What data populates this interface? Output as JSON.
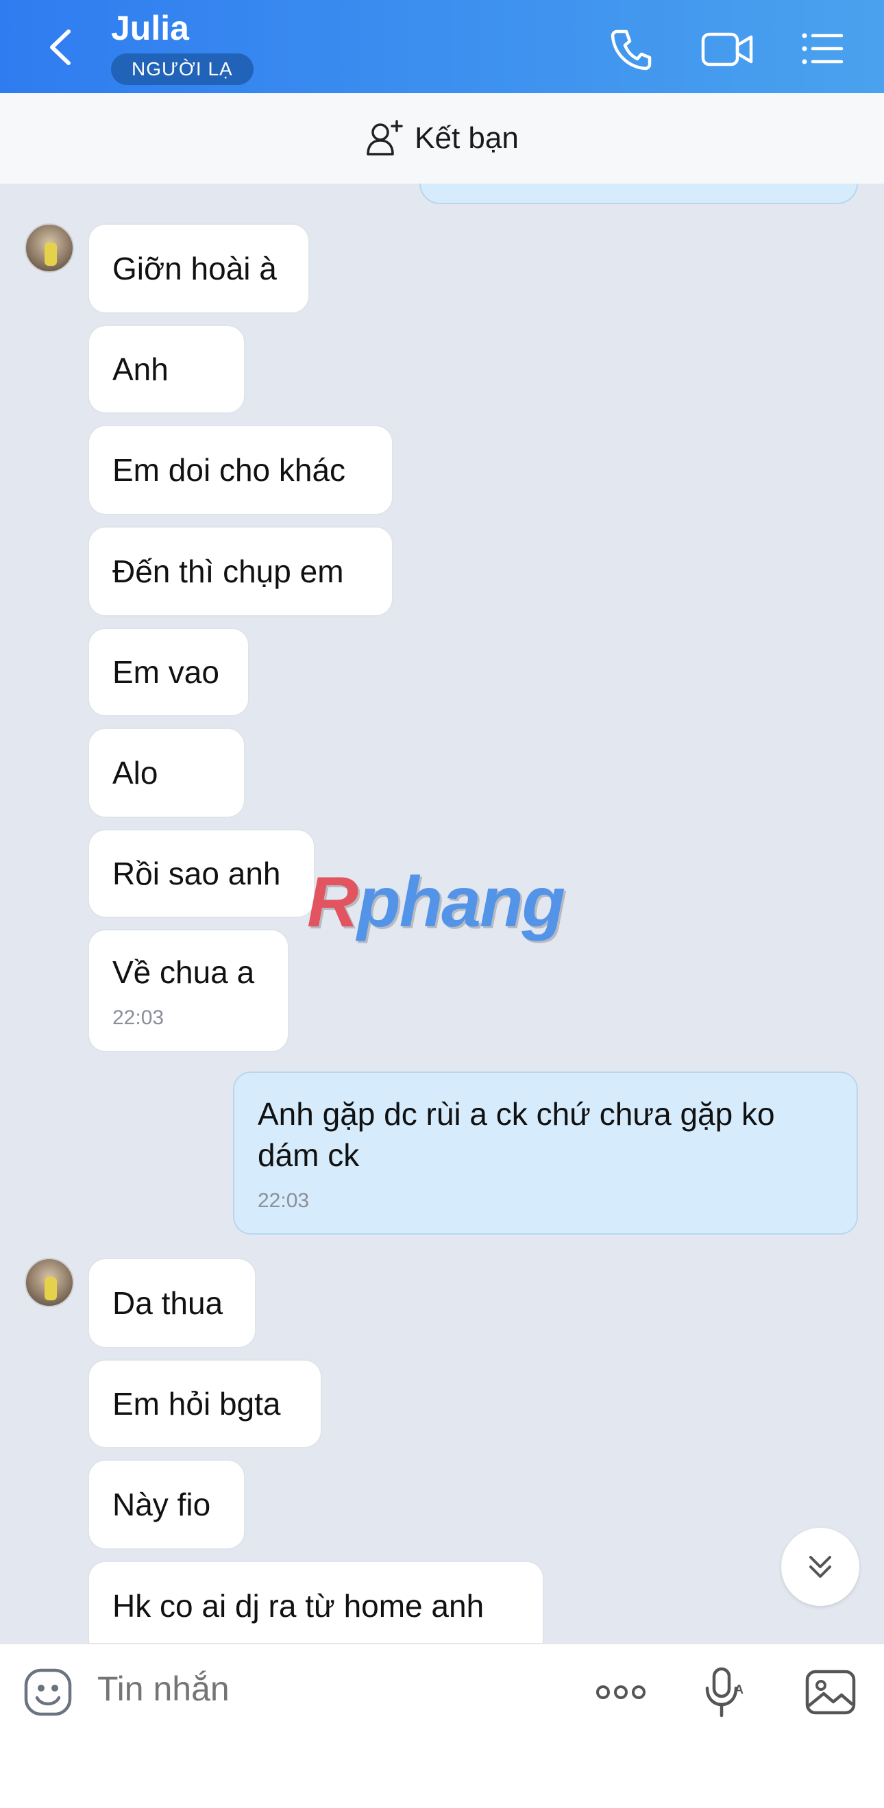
{
  "header": {
    "contact_name": "Julia",
    "badge": "NGƯỜI LẠ",
    "icons": [
      "back-icon",
      "phone-icon",
      "video-icon",
      "menu-list-icon"
    ],
    "gradient_colors": [
      "#2f7cf0",
      "#4aa2ee"
    ]
  },
  "friend_bar": {
    "label": "Kết bạn",
    "icon": "add-friend-icon"
  },
  "messages": [
    {
      "from": "contact",
      "text": "Giỡn hoài à"
    },
    {
      "from": "contact",
      "text": "Anh"
    },
    {
      "from": "contact",
      "text": "Em doi cho khác"
    },
    {
      "from": "contact",
      "text": "Đến thì chụp em"
    },
    {
      "from": "contact",
      "text": "Em vao"
    },
    {
      "from": "contact",
      "text": "Alo"
    },
    {
      "from": "contact",
      "text": "Rồi sao anh"
    },
    {
      "from": "contact",
      "text": "Về chua a",
      "time": "22:03"
    },
    {
      "from": "me",
      "text": "Anh gặp dc rùi a ck chứ chưa gặp ko dám ck",
      "time": "22:03"
    },
    {
      "from": "contact",
      "text": "Da thua"
    },
    {
      "from": "contact",
      "text": "Em hỏi bgta"
    },
    {
      "from": "contact",
      "text": "Này fio"
    },
    {
      "from": "contact",
      "text": "Hk co ai dj ra từ home anh"
    }
  ],
  "watermark": {
    "first": "R",
    "rest": "phang"
  },
  "input": {
    "placeholder": "Tin nhắn",
    "icons": [
      "emoji-icon",
      "more-icon",
      "voice-icon",
      "image-icon"
    ]
  },
  "colors": {
    "my_bubble": "#d6ebfb",
    "their_bubble": "#ffffff",
    "chat_bg": "#e3e8f0"
  }
}
